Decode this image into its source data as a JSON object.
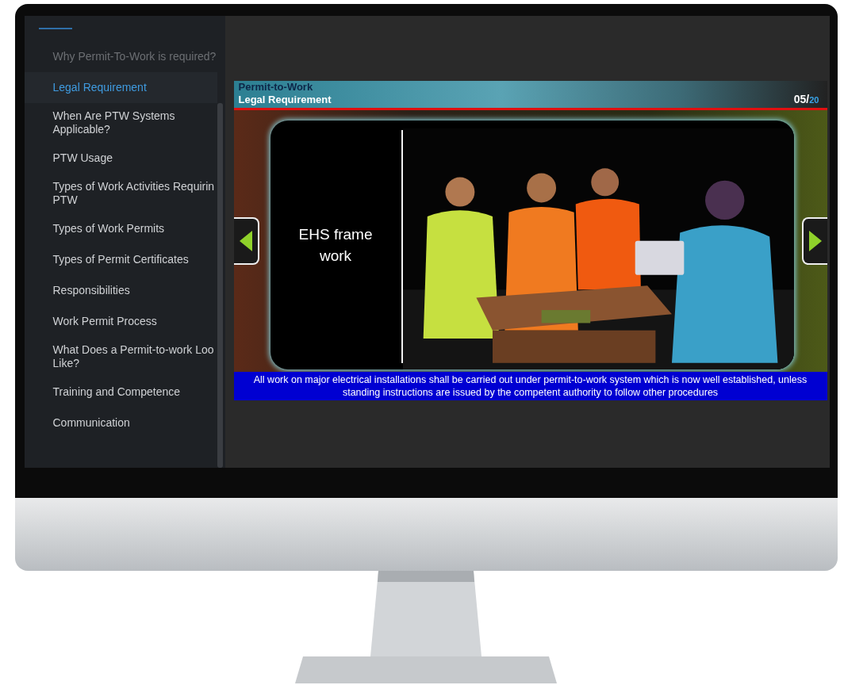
{
  "sidebar": {
    "items": [
      {
        "lines": [
          "Why Permit-To-Work is required?"
        ],
        "selected": false,
        "disabled": true
      },
      {
        "lines": [
          "Legal Requirement"
        ],
        "selected": true,
        "disabled": false
      },
      {
        "lines": [
          "When Are PTW Systems",
          "Applicable?"
        ],
        "selected": false,
        "disabled": false
      },
      {
        "lines": [
          "PTW Usage"
        ],
        "selected": false,
        "disabled": false
      },
      {
        "lines": [
          "Types of Work Activities Requirin",
          "PTW"
        ],
        "selected": false,
        "disabled": false
      },
      {
        "lines": [
          "Types of Work Permits"
        ],
        "selected": false,
        "disabled": false
      },
      {
        "lines": [
          "Types of Permit Certificates"
        ],
        "selected": false,
        "disabled": false
      },
      {
        "lines": [
          "Responsibilities"
        ],
        "selected": false,
        "disabled": false
      },
      {
        "lines": [
          "Work Permit Process"
        ],
        "selected": false,
        "disabled": false
      },
      {
        "lines": [
          "What Does a Permit-to-work Loo",
          "Like?"
        ],
        "selected": false,
        "disabled": false
      },
      {
        "lines": [
          "Training and Competence"
        ],
        "selected": false,
        "disabled": false
      },
      {
        "lines": [
          "Communication"
        ],
        "selected": false,
        "disabled": false
      }
    ]
  },
  "slide": {
    "course": "Permit-to-Work",
    "topic": "Legal Requirement",
    "counter": {
      "current": "05",
      "separator": "/",
      "total": "20"
    },
    "frame_text": "EHS frame work",
    "caption": "All work on major electrical installations shall be carried out under permit-to-work system which is now well established, unless standing instructions are issued by the competent authority to follow other procedures"
  }
}
